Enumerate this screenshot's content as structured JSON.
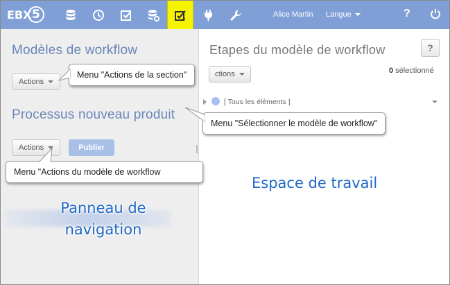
{
  "app": {
    "logo_text": "EBX",
    "logo_digit": "5"
  },
  "topbar": {
    "icons": [
      "database-icon",
      "clock-icon",
      "checkbox-icon",
      "data-services-icon",
      "workflow-model-icon",
      "plug-icon",
      "wrench-icon"
    ],
    "active_icon": "workflow-model-icon",
    "user_name": "Alice Martin",
    "language_label": "Langue",
    "help_label": "?",
    "power_icon": "power-icon",
    "colors": {
      "bar": "#7f9fd6",
      "active": "#f5f300"
    }
  },
  "left_panel": {
    "section_title": "Modèles de workflow",
    "section_actions_label": "Actions",
    "model_title": "Processus nouveau produit",
    "model_actions_label": "Actions",
    "publish_label": "Publier",
    "area_label_line1": "Panneau de",
    "area_label_line2": "navigation"
  },
  "right_panel": {
    "title": "Etapes du modèle de workflow",
    "help_label": "?",
    "actions_label": "ctions",
    "selected_count": "0",
    "selected_suffix": " sélectionné",
    "tree_item_label": "[ Tous les éléments ]",
    "area_label": "Espace de travail"
  },
  "callouts": {
    "section_actions": "Menu \"Actions de la section\"",
    "select_model": "Menu \"Sélectionner le modèle de workflow\"",
    "model_actions": "Menu \"Actions du modèle  de workflow"
  }
}
